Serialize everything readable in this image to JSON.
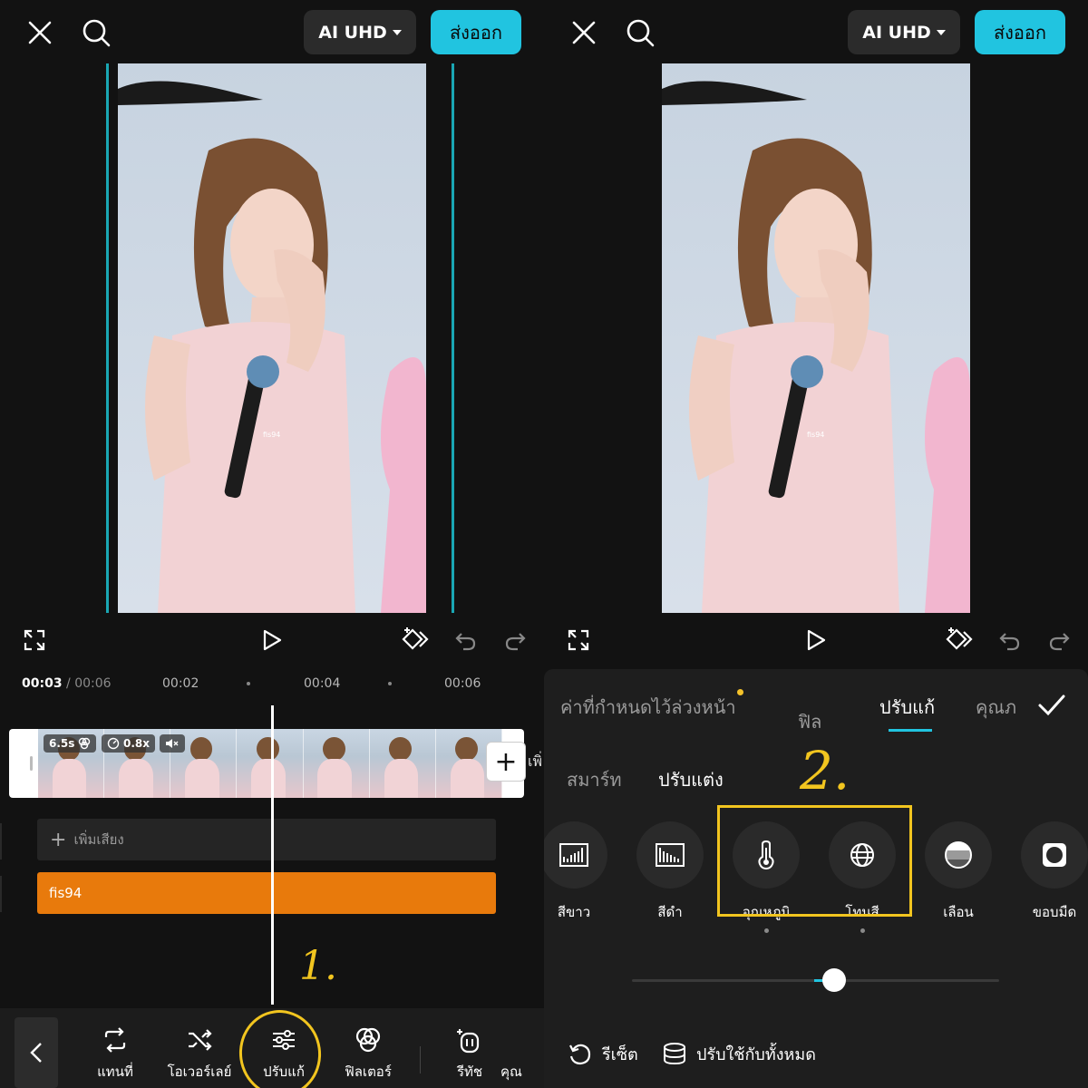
{
  "top_bar": {
    "quality_label": "AI UHD",
    "export_label": "ส่งออก"
  },
  "timeline": {
    "current_time": "00:03",
    "total_time": "/ 00:06",
    "ticks": [
      "00:02",
      "00:04",
      "00:06"
    ],
    "clip_duration": "6.5s",
    "clip_speed": "0.8x",
    "more_label": "เพิ่",
    "add_audio_label": "เพิ่มเสียง",
    "text_track_label": "fis94"
  },
  "bottom_toolbar": {
    "items": [
      {
        "label": "แทนที่",
        "icon": "replace-icon"
      },
      {
        "label": "โอเวอร์เลย์",
        "icon": "overlay-icon"
      },
      {
        "label": "ปรับแก้",
        "icon": "adjust-sliders-icon"
      },
      {
        "label": "ฟิลเตอร์",
        "icon": "filter-icon"
      },
      {
        "label": "รีทัช",
        "icon": "retouch-icon"
      },
      {
        "label": "คุณ",
        "icon": ""
      }
    ]
  },
  "adjust_panel": {
    "tabs": [
      "ค่าที่กำหนดไว้ล่วงหน้า",
      "ฟิล",
      "ปรับแก้",
      "คุณภ"
    ],
    "active_tab": "ปรับแก้",
    "subtabs": [
      "สมาร์ท",
      "ปรับแต่ง"
    ],
    "active_subtab": "ปรับแต่ง",
    "tools": [
      {
        "label": "สีขาว",
        "icon": "whites-icon"
      },
      {
        "label": "สีดำ",
        "icon": "blacks-icon"
      },
      {
        "label": "อุณหภูมิ",
        "icon": "temperature-icon"
      },
      {
        "label": "โทนสี",
        "icon": "tint-icon"
      },
      {
        "label": "เลือน",
        "icon": "fade-icon"
      },
      {
        "label": "ขอบมืด",
        "icon": "vignette-icon"
      }
    ],
    "slider_value_fraction": 0.55,
    "reset_label": "รีเซ็ต",
    "apply_all_label": "ปรับใช้กับทั้งหมด"
  },
  "annotations": {
    "step1": "1.",
    "step2": "2."
  },
  "watermark": "fis94",
  "colors": {
    "accent": "#21c4e0",
    "annotation": "#f2c51f",
    "text_track": "#e87a0c"
  }
}
